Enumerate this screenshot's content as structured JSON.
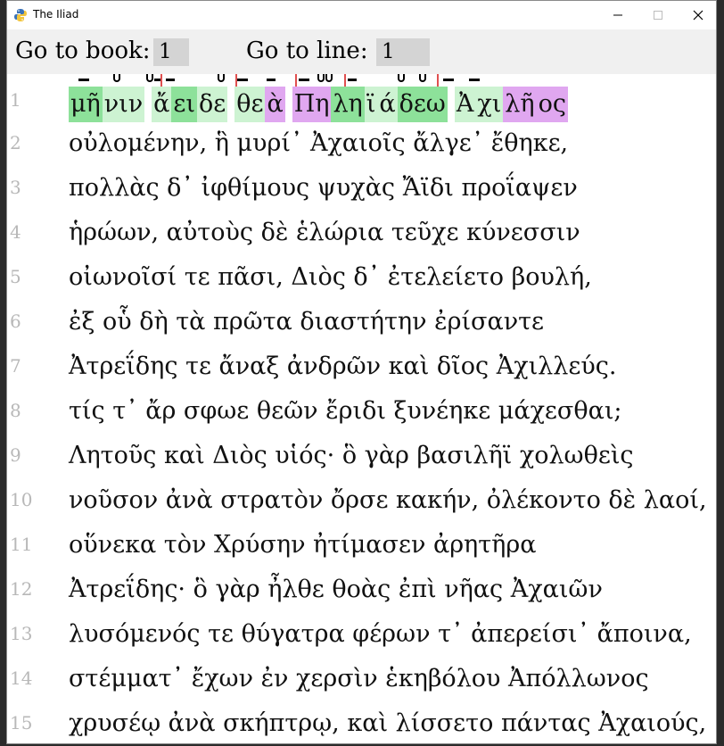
{
  "window": {
    "title": "The Iliad",
    "app_icon": "python-icon",
    "controls": [
      "minimize-icon",
      "maximize-icon",
      "close-icon"
    ]
  },
  "goto": {
    "book_label": "Go to book:",
    "book_value": "1",
    "line_label": "Go to line:",
    "line_value": "1"
  },
  "colors": {
    "long": "#8de19a",
    "short": "#cdf3d2",
    "pink": "#e0a7f0",
    "line_number": "#b8b8b8",
    "goto_bg": "#f0f0f0",
    "input_bg": "#d4d4d4"
  },
  "scansion": {
    "line_number": "1",
    "syllables": [
      {
        "text": "μῆ",
        "kind": "long"
      },
      {
        "text": "νιν",
        "kind": "short"
      },
      {
        "text": " ",
        "kind": "gap"
      },
      {
        "text": "ἄ",
        "kind": "short"
      },
      {
        "text": "ει",
        "kind": "long"
      },
      {
        "text": "δε",
        "kind": "short"
      },
      {
        "text": " ",
        "kind": "gap"
      },
      {
        "text": "θε",
        "kind": "short"
      },
      {
        "text": "ὰ",
        "kind": "pink"
      },
      {
        "text": " ",
        "kind": "gap"
      },
      {
        "text": "Πη",
        "kind": "pink"
      },
      {
        "text": "λη",
        "kind": "long"
      },
      {
        "text": "ϊ",
        "kind": "short"
      },
      {
        "text": "ά",
        "kind": "short"
      },
      {
        "text": "δεω",
        "kind": "long"
      },
      {
        "text": " ",
        "kind": "gap"
      },
      {
        "text": "Ἀ",
        "kind": "short"
      },
      {
        "text": "χι",
        "kind": "short"
      },
      {
        "text": "λῆ",
        "kind": "pink"
      },
      {
        "text": "ος",
        "kind": "pink"
      }
    ]
  },
  "lines": [
    {
      "num": "2",
      "text": "οὐλομένην, ἣ μυρί᾽ Ἀχαιοῖς ἄλγε᾽ ἔθηκε,"
    },
    {
      "num": "3",
      "text": "πολλὰς δ᾽ ἰφθίμους ψυχὰς Ἄϊδι προΐαψεν"
    },
    {
      "num": "4",
      "text": "ἡρώων, αὐτοὺς δὲ ἑλώρια τεῦχε κύνεσσιν"
    },
    {
      "num": "5",
      "text": "οἰωνοῖσί τε πᾶσι, Διὸς δ᾽ ἐτελείετο βουλή,"
    },
    {
      "num": "6",
      "text": "ἐξ οὗ δὴ τὰ πρῶτα διαστήτην ἐρίσαντε"
    },
    {
      "num": "7",
      "text": "Ἀτρεΐδης τε ἄναξ ἀνδρῶν καὶ δῖος Ἀχιλλεύς."
    },
    {
      "num": "8",
      "text": "τίς τ᾽ ἄρ σφωε θεῶν ἔριδι ξυνέηκε μάχεσθαι;"
    },
    {
      "num": "9",
      "text": "Λητοῦς καὶ Διὸς υἱός· ὃ γὰρ βασιλῆϊ χολωθεὶς"
    },
    {
      "num": "10",
      "text": "νοῦσον ἀνὰ στρατὸν ὄρσε κακήν, ὀλέκοντο δὲ λαοί,"
    },
    {
      "num": "11",
      "text": "οὕνεκα τὸν Χρύσην ἠτίμασεν ἀρητῆρα"
    },
    {
      "num": "12",
      "text": "Ἀτρεΐδης· ὃ γὰρ ἦλθε θοὰς ἐπὶ νῆας Ἀχαιῶν"
    },
    {
      "num": "13",
      "text": "λυσόμενός τε θύγατρα φέρων τ᾽ ἀπερείσι᾽ ἄποινα,"
    },
    {
      "num": "14",
      "text": "στέμματ᾽ ἔχων ἐν χερσὶν ἑκηβόλου Ἀπόλλωνος"
    },
    {
      "num": "15",
      "text": "χρυσέῳ ἀνὰ σκήπτρῳ, καὶ λίσσετο πάντας Ἀχαιούς,"
    }
  ]
}
